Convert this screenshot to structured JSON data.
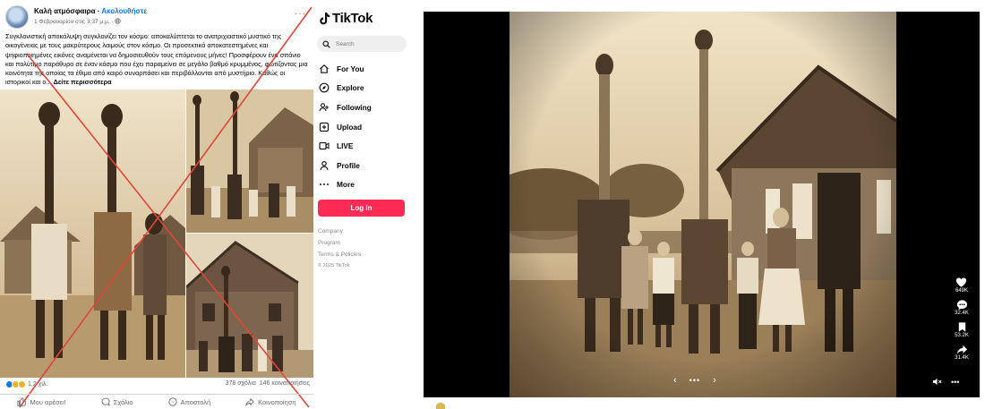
{
  "facebook": {
    "page_name": "Καλή ατμόσφαιρα",
    "separator": " · ",
    "follow_label": "Ακολουθήστε",
    "timestamp": "1 Φεβρουαρίου στις 3:37 μ.μ. · ",
    "post_text": "Συγκλονιστική αποκάλυψη συγκλονίζει τον κόσμο: αποκαλύπτεται το ανατριχιαστικό μυστικό της οικογένειας με τους μακρύτερους λαιμούς στον κόσμο. Οι προσεκτικά αποκατεστημένες και ψηφιοποιημένες εικόνες αναμένεται να δημοσιευθούν τους επόμενους μήνες! Προσφέρουν ένα σπάνιο και πολύτιμο παράθυρο σε έναν κόσμο που έχει παραμείνει σε μεγάλο βαθμό κρυμμένος, φωτίζοντας μια κοινότητα της οποίας τα έθιμα από καιρό συναρπάσει και περιβάλλονται από μυστήριο. Καθώς οι ιστορικοί και ο... ",
    "see_more": "Δείτε περισσότερα",
    "reactions_count": "1,2 χιλ.",
    "comments_count": "378 σχόλια",
    "shares_count": "146 κοινοποιήσεις",
    "actions": {
      "like": "Μου αρέσει!",
      "comment": "Σχόλιο",
      "send": "Αποστολή",
      "share": "Κοινοποίηση"
    },
    "cross_color": "#e0463a"
  },
  "tiktok": {
    "logo_text": "TikTok",
    "search_placeholder": "Search",
    "nav": [
      {
        "label": "For You",
        "icon": "home-icon"
      },
      {
        "label": "Explore",
        "icon": "compass-icon"
      },
      {
        "label": "Following",
        "icon": "following-icon"
      },
      {
        "label": "Upload",
        "icon": "upload-icon"
      },
      {
        "label": "LIVE",
        "icon": "live-icon"
      },
      {
        "label": "Profile",
        "icon": "profile-icon"
      },
      {
        "label": "More",
        "icon": "more-icon"
      }
    ],
    "login_label": "Log In",
    "login_color": "#fe2c55",
    "footer": {
      "company": "Company",
      "program": "Program",
      "terms": "Terms & Policies",
      "copyright": "© 2025 TikTok"
    }
  },
  "video": {
    "likes": "649K",
    "comments": "32.4K",
    "saves": "53.2K",
    "shares": "31.4K",
    "nav_prev": "‹",
    "nav_dots": "•••",
    "nav_next": "›",
    "more": "•••"
  }
}
